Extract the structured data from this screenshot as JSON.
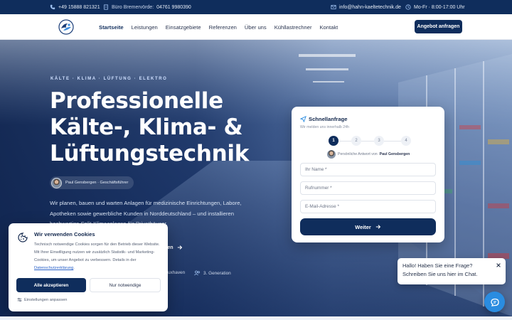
{
  "topbar": {
    "phone": "+49 15888 821321",
    "office_label": "Büro Bremervörde:",
    "office_phone": "04761 9980390",
    "email": "info@hahn-kaeltetechnik.de",
    "hours": "Mo-Fr · 8:00-17:00 Uhr"
  },
  "nav": {
    "items": [
      "Startseite",
      "Leistungen",
      "Einsatzgebiete",
      "Referenzen",
      "Über uns",
      "Kühllastrechner",
      "Kontakt"
    ],
    "cta": "Angebot anfragen"
  },
  "hero": {
    "eyebrow": "KÄLTE · KLIMA · LÜFTUNG · ELEKTRO",
    "title_lines": [
      "Professionelle",
      "Kälte-, Klima- &",
      "Lüftungstechnik"
    ],
    "author": "Paul Gensbergen · Geschäftsführer",
    "lead": "Wir planen, bauen und warten Anlagen für medizinische Einrichtungen, Labore, Apotheken sowie gewerbliche Kunden in Norddeutschland – und installieren hochwertige Split-Klimaanlagen für Privathäuser.",
    "link_text": "echnen",
    "trust": [
      "uxhaven",
      "3. Generation"
    ]
  },
  "quick_request": {
    "title": "Schnellanfrage",
    "subtitle": "Wir melden uns innerhalb 24h",
    "steps": [
      "1",
      "2",
      "3",
      "4"
    ],
    "active_step": 1,
    "person_prefix": "Persönliche Antwort von",
    "person_name": "Paul Gensbergen",
    "fields": {
      "name_placeholder": "Ihr Name *",
      "phone_placeholder": "Rufnummer *",
      "email_placeholder": "E-Mail-Adresse *"
    },
    "submit": "Weiter"
  },
  "cookie": {
    "title": "Wir verwenden Cookies",
    "text": "Technisch notwendige Cookies sorgen für den Betrieb dieser Website. Mit Ihrer Einwilligung nutzen wir zusätzlich Statistik- und Marketing-Cookies, um unser Angebot zu verbessern. Details in der",
    "link": "Datenschutzerklärung",
    "text_end": ".",
    "accept": "Alle akzeptieren",
    "necessary": "Nur notwendige",
    "settings": "Einstellungen anpassen"
  },
  "chat": {
    "line1": "Hallo! Haben Sie eine Frage?",
    "line2": "Schreiben Sie uns hier im Chat."
  },
  "colors": {
    "primary": "#0f2d5c",
    "chat_accent": "#2a8ce0",
    "link": "#2c63c9"
  }
}
